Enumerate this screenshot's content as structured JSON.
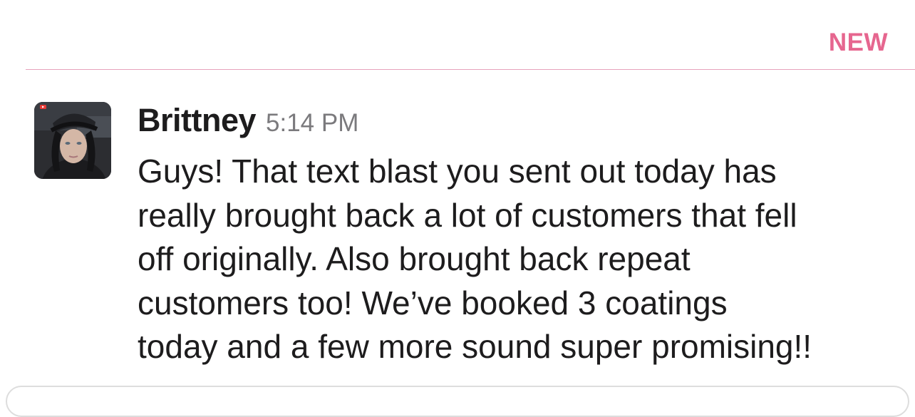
{
  "unread_divider": {
    "label": "NEW",
    "color": "#e6668f"
  },
  "message": {
    "avatar_icon": "user-photo",
    "sender": "Brittney",
    "time": "5:14 PM",
    "lines": [
      "Guys! That text blast you sent out today has",
      "really brought back a lot of customers that fell",
      "off originally. Also brought back repeat",
      "customers too! We’ve booked 3 coatings",
      "today and a few more sound super promising!!"
    ]
  }
}
